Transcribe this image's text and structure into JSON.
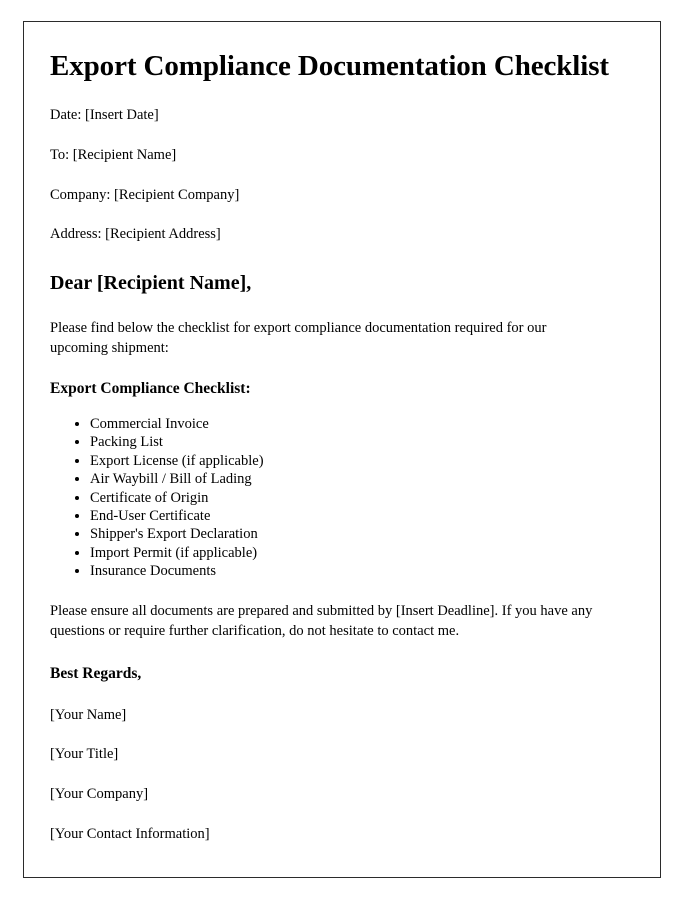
{
  "document": {
    "title": "Export Compliance Documentation Checklist",
    "meta_lines": [
      "Date: [Insert Date]",
      "To: [Recipient Name]",
      "Company: [Recipient Company]",
      "Address: [Recipient Address]"
    ],
    "salutation": "Dear [Recipient Name],",
    "intro_paragraph": "Please find below the checklist for export compliance documentation required for our upcoming shipment:",
    "checklist_heading": "Export Compliance Checklist:",
    "checklist_items": [
      "Commercial Invoice",
      "Packing List",
      "Export License (if applicable)",
      "Air Waybill / Bill of Lading",
      "Certificate of Origin",
      "End-User Certificate",
      "Shipper's Export Declaration",
      "Import Permit (if applicable)",
      "Insurance Documents"
    ],
    "closing_paragraph": "Please ensure all documents are prepared and submitted by [Insert Deadline]. If you have any questions or require further clarification, do not hesitate to contact me.",
    "regards": "Best Regards,",
    "signature_lines": [
      "[Your Name]",
      "[Your Title]",
      "[Your Company]",
      "[Your Contact Information]"
    ]
  },
  "style": {
    "page_background": "#ffffff",
    "text_color": "#000000",
    "border_color": "#2b2b2b"
  }
}
